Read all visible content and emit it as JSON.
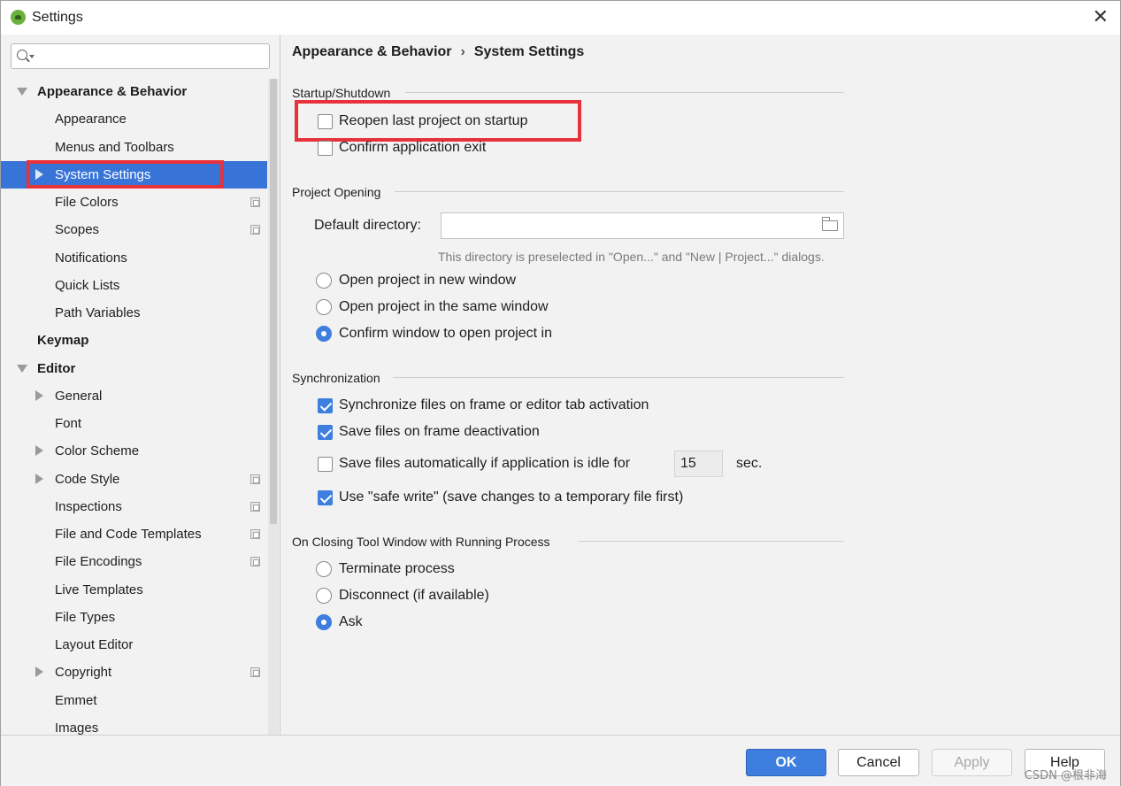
{
  "window": {
    "title": "Settings",
    "close": "✕"
  },
  "search": {
    "placeholder": ""
  },
  "sidebar": {
    "items": [
      {
        "label": "Appearance & Behavior"
      },
      {
        "label": "Appearance"
      },
      {
        "label": "Menus and Toolbars"
      },
      {
        "label": "System Settings"
      },
      {
        "label": "File Colors"
      },
      {
        "label": "Scopes"
      },
      {
        "label": "Notifications"
      },
      {
        "label": "Quick Lists"
      },
      {
        "label": "Path Variables"
      },
      {
        "label": "Keymap"
      },
      {
        "label": "Editor"
      },
      {
        "label": "General"
      },
      {
        "label": "Font"
      },
      {
        "label": "Color Scheme"
      },
      {
        "label": "Code Style"
      },
      {
        "label": "Inspections"
      },
      {
        "label": "File and Code Templates"
      },
      {
        "label": "File Encodings"
      },
      {
        "label": "Live Templates"
      },
      {
        "label": "File Types"
      },
      {
        "label": "Layout Editor"
      },
      {
        "label": "Copyright"
      },
      {
        "label": "Emmet"
      },
      {
        "label": "Images"
      }
    ]
  },
  "breadcrumb": {
    "parent": "Appearance & Behavior",
    "separator": "›",
    "current": "System Settings"
  },
  "startup": {
    "title": "Startup/Shutdown",
    "reopen": "Reopen last project on startup",
    "confirm_exit": "Confirm application exit"
  },
  "project_opening": {
    "title": "Project Opening",
    "default_dir_label": "Default directory:",
    "default_dir_value": "",
    "hint": "This directory is preselected in \"Open...\" and \"New | Project...\" dialogs.",
    "opt_new_window": "Open project in new window",
    "opt_same_window": "Open project in the same window",
    "opt_confirm": "Confirm window to open project in",
    "selected": "Confirm window to open project in"
  },
  "sync": {
    "title": "Synchronization",
    "sync_files": "Synchronize files on frame or editor tab activation",
    "save_deactivation": "Save files on frame deactivation",
    "save_idle": "Save files automatically if application is idle for",
    "idle_seconds": "15",
    "sec_label": "sec.",
    "safe_write": "Use \"safe write\" (save changes to a temporary file first)"
  },
  "closing": {
    "title": "On Closing Tool Window with Running Process",
    "terminate": "Terminate process",
    "disconnect": "Disconnect (if available)",
    "ask": "Ask",
    "selected": "Ask"
  },
  "buttons": {
    "ok": "OK",
    "cancel": "Cancel",
    "apply": "Apply",
    "help": "Help"
  },
  "watermark": "CSDN @根非海",
  "colors": {
    "accent": "#3874d8",
    "highlight_box": "#e8323a"
  }
}
